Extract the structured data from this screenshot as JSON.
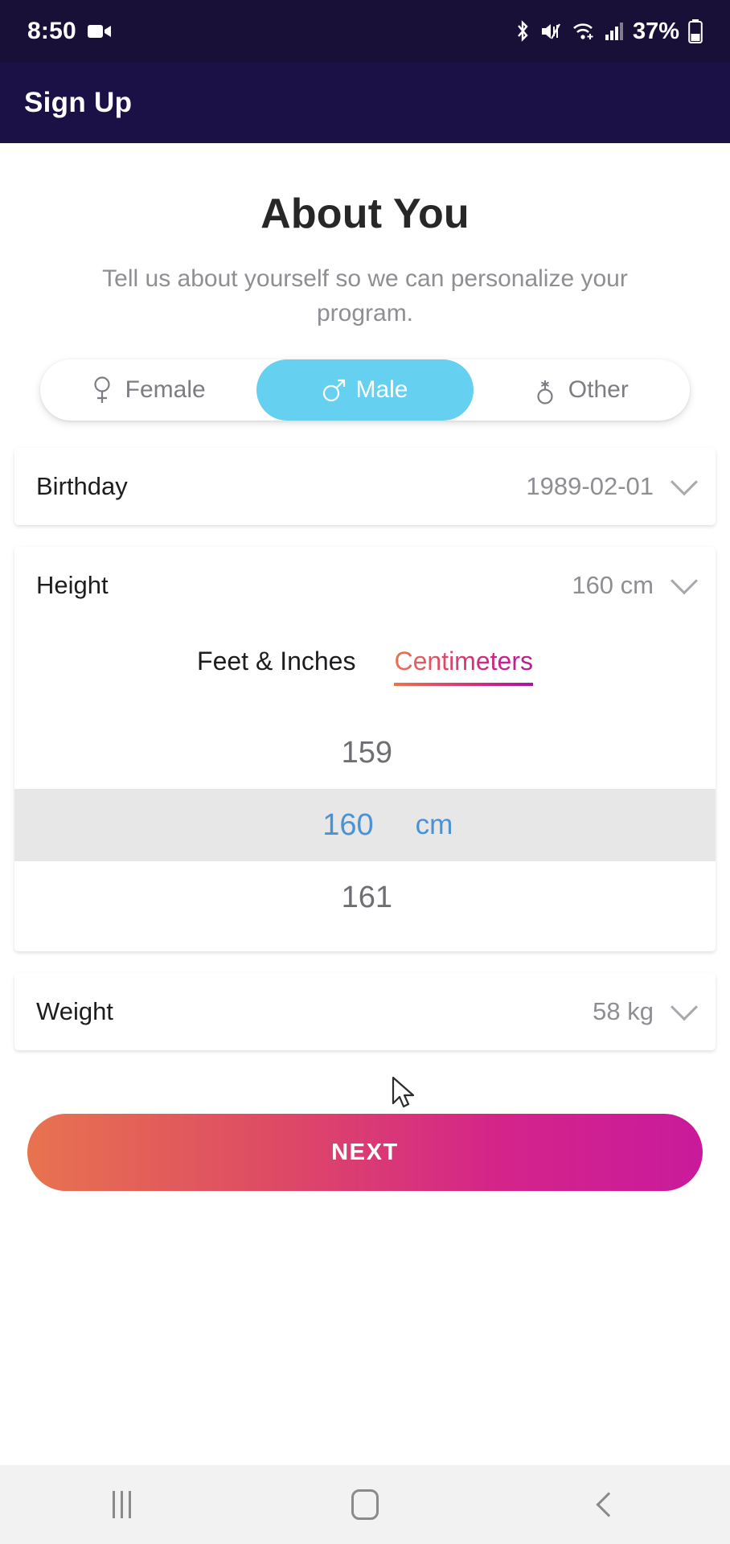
{
  "status_bar": {
    "time": "8:50",
    "battery_percent": "37%",
    "icons": [
      "video-camera-icon",
      "bluetooth-icon",
      "mute-icon",
      "wifi-icon",
      "signal-icon",
      "battery-icon"
    ]
  },
  "app_bar": {
    "title": "Sign Up"
  },
  "page": {
    "heading": "About You",
    "subheading": "Tell us about yourself so we can personalize your program."
  },
  "gender": {
    "selected": "Male",
    "options": [
      {
        "label": "Female",
        "icon": "female-icon",
        "active": false
      },
      {
        "label": "Male",
        "icon": "male-icon",
        "active": true
      },
      {
        "label": "Other",
        "icon": "other-gender-icon",
        "active": false
      }
    ],
    "active_color": "#66d0f0"
  },
  "fields": {
    "birthday": {
      "label": "Birthday",
      "value": "1989-02-01"
    },
    "height": {
      "label": "Height",
      "value": "160 cm"
    },
    "weight": {
      "label": "Weight",
      "value": "58 kg"
    }
  },
  "height_picker": {
    "tabs": [
      {
        "label": "Feet & Inches",
        "active": false
      },
      {
        "label": "Centimeters",
        "active": true
      }
    ],
    "rows": [
      {
        "number": "159",
        "unit": "",
        "selected": false
      },
      {
        "number": "160",
        "unit": "cm",
        "selected": true
      },
      {
        "number": "161",
        "unit": "",
        "selected": false
      }
    ],
    "selected_color": "#4b92d4",
    "accent_gradient_start": "#e8734f",
    "accent_gradient_end": "#b81d96"
  },
  "next_button": {
    "label": "NEXT"
  },
  "nav_bar": {
    "recents": "recents-icon",
    "home": "home-icon",
    "back": "back-icon"
  }
}
